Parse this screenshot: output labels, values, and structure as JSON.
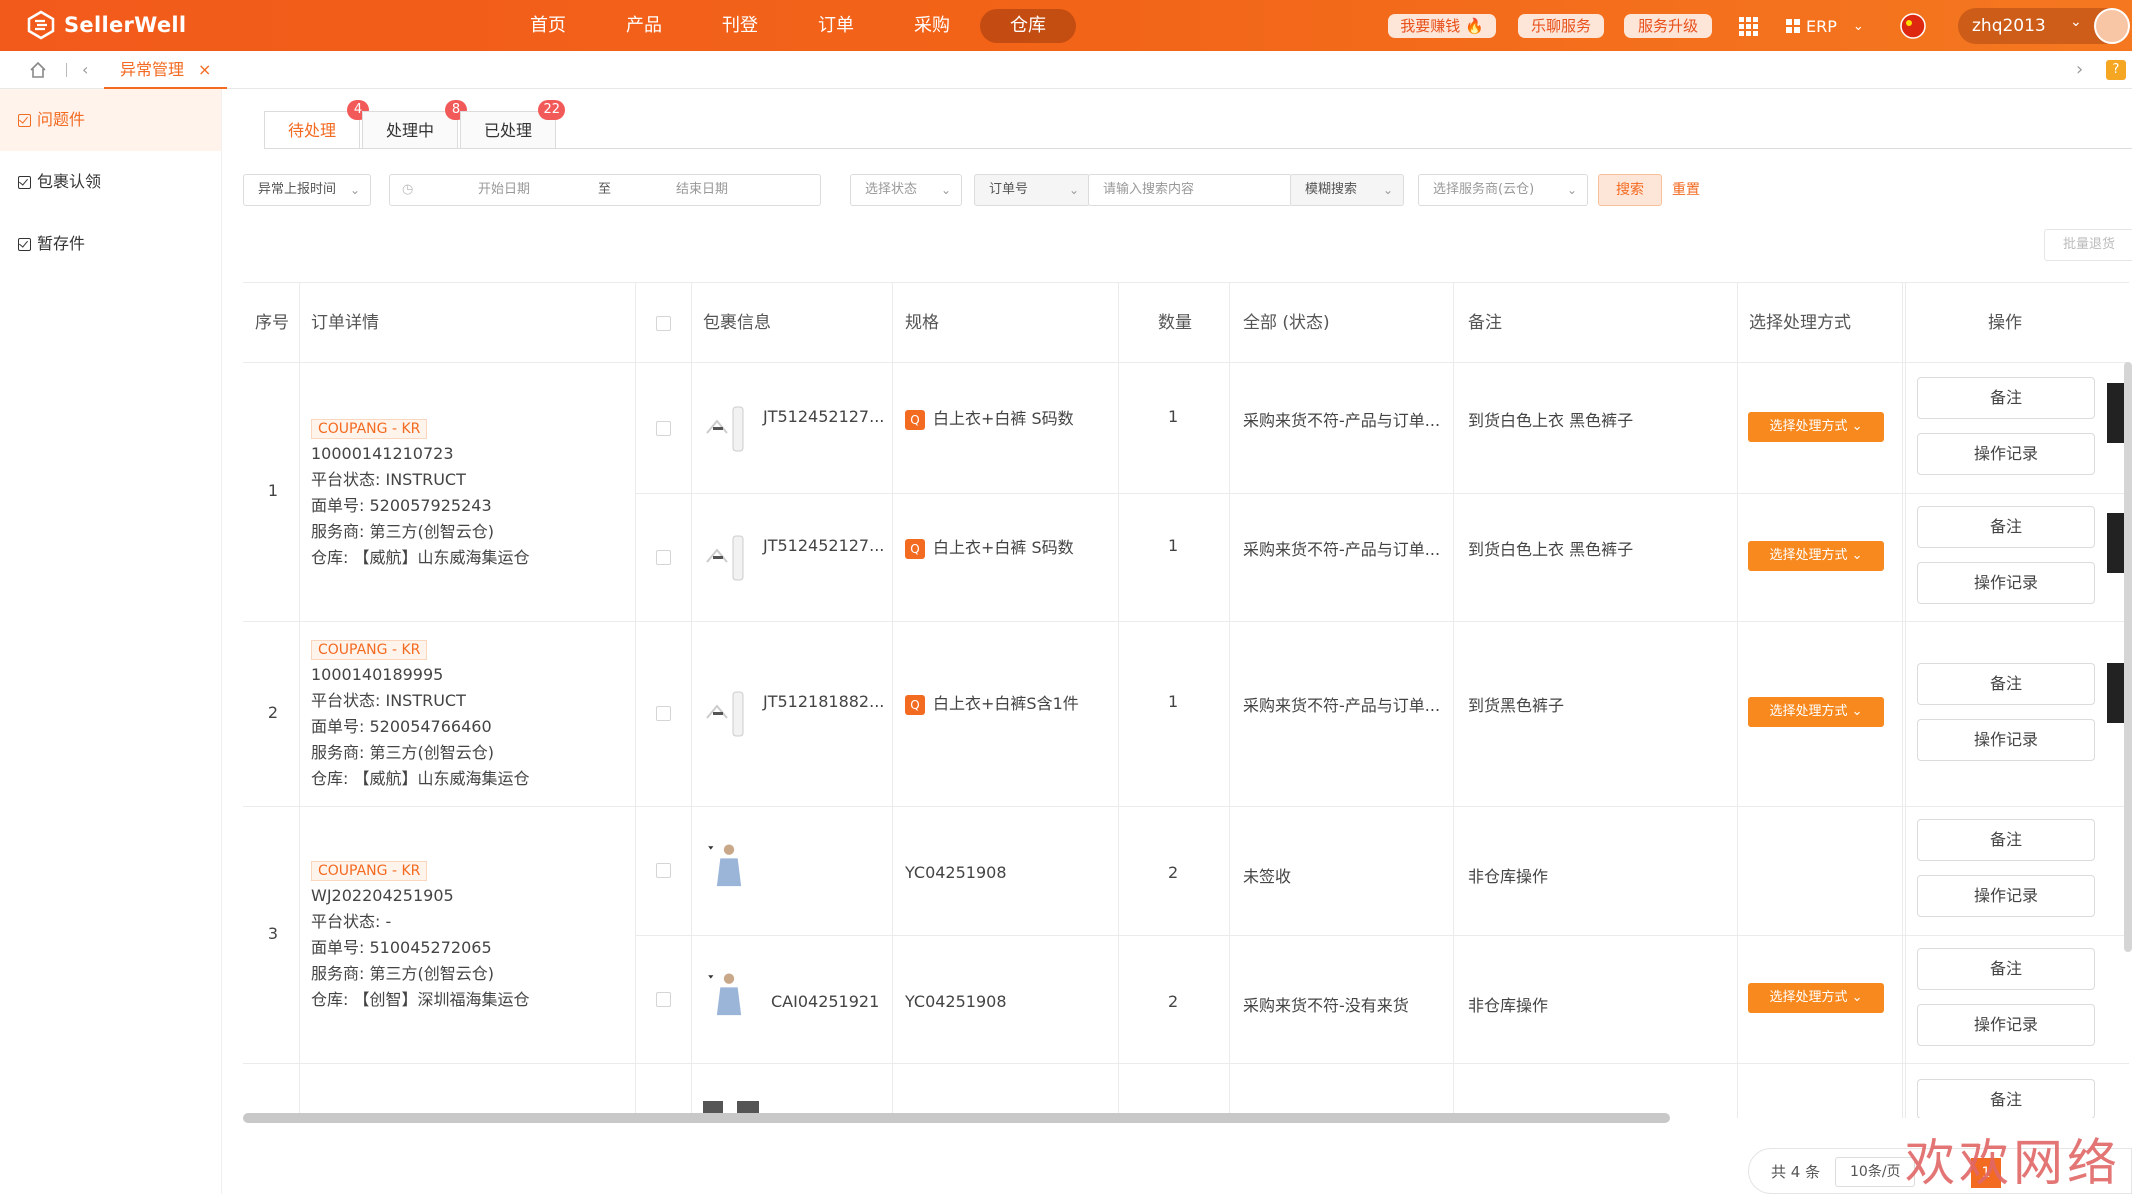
{
  "brand": {
    "name": "SellerWell"
  },
  "nav": {
    "items": [
      "首页",
      "产品",
      "刊登",
      "订单",
      "采购",
      "仓库"
    ],
    "active": "仓库",
    "earn": "我要赚钱",
    "chat": "乐聊服务",
    "upgrade": "服务升级",
    "erp": "ERP",
    "user": "zhq2013"
  },
  "tabbar": {
    "current_tab": "异常管理",
    "close": "×"
  },
  "sidebar": {
    "items": [
      "问题件",
      "包裹认领",
      "暂存件"
    ]
  },
  "subtabs": [
    {
      "label": "待处理",
      "badge": "4"
    },
    {
      "label": "处理中",
      "badge": "8"
    },
    {
      "label": "已处理",
      "badge": "22"
    }
  ],
  "filters": {
    "time_type": "异常上报时间",
    "start_placeholder": "开始日期",
    "to": "至",
    "end_placeholder": "结束日期",
    "status_placeholder": "选择状态",
    "order_field": "订单号",
    "search_placeholder": "请输入搜索内容",
    "match_mode": "模糊搜索",
    "provider_placeholder": "选择服务商(云仓)",
    "search_btn": "搜索",
    "reset_btn": "重置",
    "batch_btn": "批量退货"
  },
  "table": {
    "headers": {
      "seq": "序号",
      "order": "订单详情",
      "package": "包裹信息",
      "spec": "规格",
      "qty": "数量",
      "status": "全部 (状态)",
      "remark": "备注",
      "method": "选择处理方式",
      "ops": "操作"
    },
    "orders": [
      {
        "seq": "1",
        "platform": "COUPANG - KR",
        "order_no": "10000141210723",
        "platform_status": "平台状态: INSTRUCT",
        "waybill": "面单号: 520057925243",
        "provider": "服务商: 第三方(创智云仓)",
        "warehouse": "仓库: 【威航】山东威海集运仓",
        "rows": [
          {
            "package": "JT512452127...",
            "spec": "白上衣+白裤 S码数",
            "qty": "1",
            "status": "采购来货不符-产品与订单...",
            "remark": "到货白色上衣 黑色裤子",
            "method": "选择处理方式"
          },
          {
            "package": "JT512452127...",
            "spec": "白上衣+白裤 S码数",
            "qty": "1",
            "status": "采购来货不符-产品与订单...",
            "remark": "到货白色上衣 黑色裤子",
            "method": "选择处理方式"
          }
        ]
      },
      {
        "seq": "2",
        "platform": "COUPANG - KR",
        "order_no": "1000140189995",
        "platform_status": "平台状态: INSTRUCT",
        "waybill": "面单号: 520054766460",
        "provider": "服务商: 第三方(创智云仓)",
        "warehouse": "仓库: 【威航】山东威海集运仓",
        "rows": [
          {
            "package": "JT512181882...",
            "spec": "白上衣+白裤S含1件",
            "qty": "1",
            "status": "采购来货不符-产品与订单...",
            "remark": "到货黑色裤子",
            "method": "选择处理方式"
          }
        ]
      },
      {
        "seq": "3",
        "platform": "COUPANG - KR",
        "order_no": "WJ202204251905",
        "platform_status": "平台状态: -",
        "waybill": "面单号: 510045272065",
        "provider": "服务商: 第三方(创智云仓)",
        "warehouse": "仓库: 【创智】深圳福海集运仓",
        "rows": [
          {
            "package": "",
            "spec": "YC04251908",
            "qty": "2",
            "status": "未签收",
            "remark": "非仓库操作",
            "method": ""
          },
          {
            "package": "CAI04251921",
            "spec": "YC04251908",
            "qty": "2",
            "status": "采购来货不符-没有来货",
            "remark": "非仓库操作",
            "method": "选择处理方式"
          }
        ]
      }
    ],
    "op_remark": "备注",
    "op_log": "操作记录",
    "op_remark_partial": "备注"
  },
  "pager": {
    "total": "共 4 条",
    "size": "10条/页",
    "page": "1"
  },
  "watermark": "欢欢网络"
}
